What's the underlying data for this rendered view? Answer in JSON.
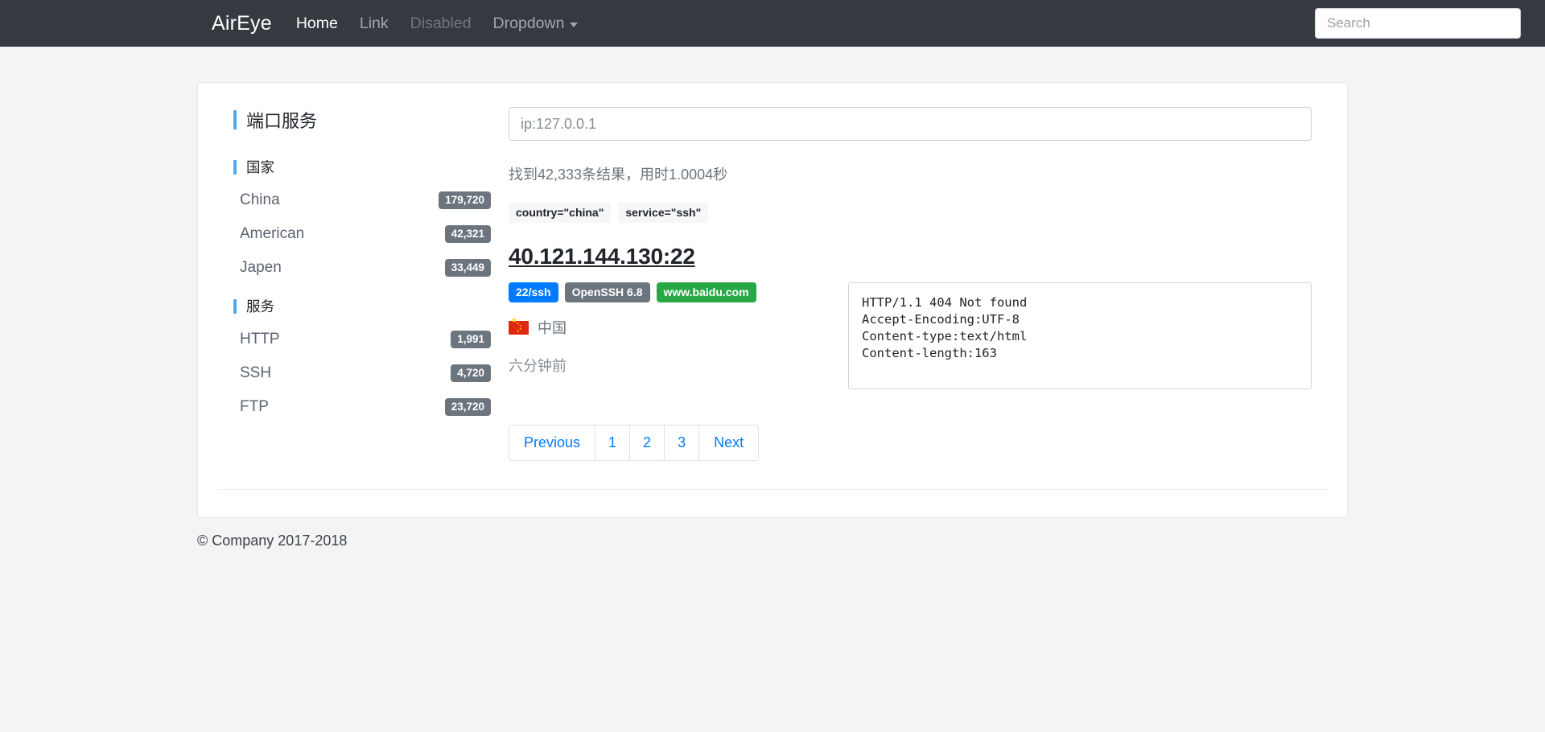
{
  "navbar": {
    "brand": "AirEye",
    "links": [
      {
        "label": "Home",
        "state": "active"
      },
      {
        "label": "Link",
        "state": "normal"
      },
      {
        "label": "Disabled",
        "state": "disabled"
      },
      {
        "label": "Dropdown",
        "state": "dropdown"
      }
    ],
    "search_placeholder": "Search",
    "search_value": "",
    "background_color": "#343a40"
  },
  "sidebar": {
    "title": "端口服务",
    "groups": [
      {
        "heading": "国家",
        "items": [
          {
            "label": "China",
            "count": "179,720"
          },
          {
            "label": "American",
            "count": "42,321"
          },
          {
            "label": "Japen",
            "count": "33,449"
          }
        ]
      },
      {
        "heading": "服务",
        "items": [
          {
            "label": "HTTP",
            "count": "1,991"
          },
          {
            "label": "SSH",
            "count": "4,720"
          },
          {
            "label": "FTP",
            "count": "23,720"
          }
        ]
      }
    ],
    "accent_color": "#4aabf0",
    "badge_color": "#6c757d"
  },
  "results": {
    "query_placeholder": "ip:127.0.0.1",
    "query_value": "",
    "stats": "找到42,333条结果，用时1.0004秒",
    "filters": [
      "country=\"china\"",
      "service=\"ssh\""
    ],
    "entry": {
      "title": "40.121.144.130:22",
      "tags": [
        {
          "text": "22/ssh",
          "color": "#007bff"
        },
        {
          "text": "OpenSSH 6.8",
          "color": "#6c757d"
        },
        {
          "text": "www.baidu.com",
          "color": "#28a745"
        }
      ],
      "country_flag": "cn-flag-icon",
      "country_name": "中国",
      "time_ago": "六分钟前",
      "banner": [
        "HTTP/1.1 404 Not found",
        "Accept-Encoding:UTF-8",
        "Content-type:text/html",
        "Content-length:163"
      ]
    },
    "pagination": [
      {
        "label": "Previous",
        "type": "prev"
      },
      {
        "label": "1",
        "type": "num"
      },
      {
        "label": "2",
        "type": "num"
      },
      {
        "label": "3",
        "type": "num"
      },
      {
        "label": "Next",
        "type": "next"
      }
    ]
  },
  "footer": {
    "copyright": "© Company 2017-2018"
  }
}
